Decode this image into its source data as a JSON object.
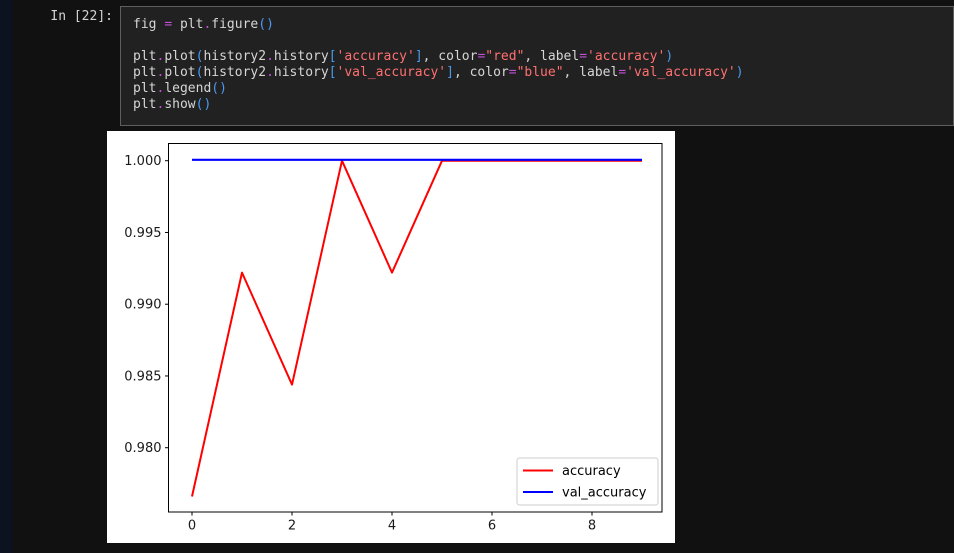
{
  "theme": {
    "page_bg": "#111111",
    "left_strip_bg": "#0d1220",
    "cell_bg": "#212121",
    "cell_border": "#5e5e5e",
    "code_default_color": "#d6d6d6",
    "operator_color": "#c44fd8",
    "string_color": "#ff7070",
    "bracket_color": "#4a9af0"
  },
  "cell": {
    "prompt": "In [22]:",
    "code_lines": [
      [
        {
          "t": "fig ",
          "c": "v"
        },
        {
          "t": "=",
          "c": "op"
        },
        {
          "t": " plt",
          "c": "v"
        },
        {
          "t": ".",
          "c": "op"
        },
        {
          "t": "figure",
          "c": "v"
        },
        {
          "t": "()",
          "c": "p"
        }
      ],
      [],
      [
        {
          "t": "plt",
          "c": "v"
        },
        {
          "t": ".",
          "c": "op"
        },
        {
          "t": "plot",
          "c": "v"
        },
        {
          "t": "(",
          "c": "p"
        },
        {
          "t": "history2",
          "c": "v"
        },
        {
          "t": ".",
          "c": "op"
        },
        {
          "t": "history",
          "c": "v"
        },
        {
          "t": "[",
          "c": "p"
        },
        {
          "t": "'accuracy'",
          "c": "s"
        },
        {
          "t": "]",
          "c": "p"
        },
        {
          "t": ", color",
          "c": "v"
        },
        {
          "t": "=",
          "c": "op"
        },
        {
          "t": "\"red\"",
          "c": "s"
        },
        {
          "t": ", label",
          "c": "v"
        },
        {
          "t": "=",
          "c": "op"
        },
        {
          "t": "'accuracy'",
          "c": "s"
        },
        {
          "t": ")",
          "c": "p"
        }
      ],
      [
        {
          "t": "plt",
          "c": "v"
        },
        {
          "t": ".",
          "c": "op"
        },
        {
          "t": "plot",
          "c": "v"
        },
        {
          "t": "(",
          "c": "p"
        },
        {
          "t": "history2",
          "c": "v"
        },
        {
          "t": ".",
          "c": "op"
        },
        {
          "t": "history",
          "c": "v"
        },
        {
          "t": "[",
          "c": "p"
        },
        {
          "t": "'val_accuracy'",
          "c": "s"
        },
        {
          "t": "]",
          "c": "p"
        },
        {
          "t": ", color",
          "c": "v"
        },
        {
          "t": "=",
          "c": "op"
        },
        {
          "t": "\"blue\"",
          "c": "s"
        },
        {
          "t": ", label",
          "c": "v"
        },
        {
          "t": "=",
          "c": "op"
        },
        {
          "t": "'val_accuracy'",
          "c": "s"
        },
        {
          "t": ")",
          "c": "p"
        }
      ],
      [
        {
          "t": "plt",
          "c": "v"
        },
        {
          "t": ".",
          "c": "op"
        },
        {
          "t": "legend",
          "c": "v"
        },
        {
          "t": "()",
          "c": "p"
        }
      ],
      [
        {
          "t": "plt",
          "c": "v"
        },
        {
          "t": ".",
          "c": "op"
        },
        {
          "t": "show",
          "c": "v"
        },
        {
          "t": "()",
          "c": "p"
        }
      ]
    ]
  },
  "chart_data": {
    "type": "line",
    "title": "",
    "xlabel": "",
    "ylabel": "",
    "x": [
      0,
      1,
      2,
      3,
      4,
      5,
      6,
      7,
      8,
      9
    ],
    "series": [
      {
        "name": "accuracy",
        "color": "#ff0000",
        "values": [
          0.9766,
          0.9922,
          0.9844,
          1.0,
          0.9922,
          1.0,
          1.0,
          1.0,
          1.0,
          1.0
        ]
      },
      {
        "name": "val_accuracy",
        "color": "#0000ff",
        "values": [
          1.0,
          1.0,
          1.0,
          1.0,
          1.0,
          1.0,
          1.0,
          1.0,
          1.0,
          1.0
        ]
      }
    ],
    "xticks": {
      "values": [
        0,
        2,
        4,
        6,
        8
      ],
      "labels": [
        "0",
        "2",
        "4",
        "6",
        "8"
      ]
    },
    "yticks": {
      "values": [
        1.0,
        0.995,
        0.99,
        0.985,
        0.98
      ],
      "labels": [
        "1.000",
        "0.995",
        "0.990",
        "0.985",
        "0.980"
      ]
    },
    "xlim": [
      -0.47,
      9.4
    ],
    "ylim": [
      0.97552,
      1.0012
    ],
    "grid": false,
    "legend": {
      "position": "lower right",
      "entries": [
        "accuracy",
        "val_accuracy"
      ]
    },
    "spine_color": "#000000",
    "tick_label_color": "#1a1a1a",
    "legend_border_color": "#cccccc",
    "plot_bg": "#ffffff"
  }
}
